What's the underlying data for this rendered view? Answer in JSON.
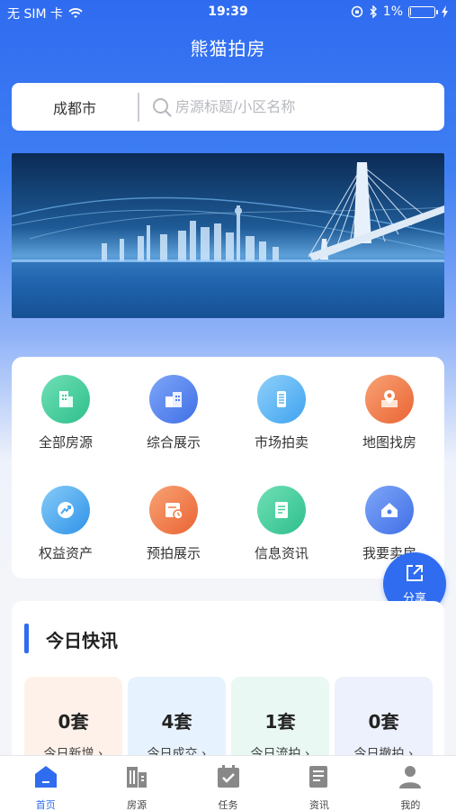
{
  "status_bar": {
    "carrier": "无 SIM 卡",
    "time": "19:39",
    "battery_text": "1%",
    "battery_level": 0.05
  },
  "header": {
    "title": "熊猫拍房"
  },
  "search": {
    "city": "成都市",
    "placeholder": "房源标题/小区名称",
    "value": ""
  },
  "banner": {
    "icon": "city-skyline-bridge-image"
  },
  "menu": {
    "items": [
      {
        "label": "全部房源",
        "icon": "building-icon",
        "color": "#3ecf9c"
      },
      {
        "label": "综合展示",
        "icon": "buildings-icon",
        "color": "#4d7ef0"
      },
      {
        "label": "市场拍卖",
        "icon": "tower-icon",
        "color": "#5db4f3"
      },
      {
        "label": "地图找房",
        "icon": "map-pin-icon",
        "color": "#f07b45"
      },
      {
        "label": "权益资产",
        "icon": "trend-icon",
        "color": "#49a8ef"
      },
      {
        "label": "预拍展示",
        "icon": "calendar-clock-icon",
        "color": "#f07b45"
      },
      {
        "label": "信息资讯",
        "icon": "document-icon",
        "color": "#3ecf9c"
      },
      {
        "label": "我要卖房",
        "icon": "house-tag-icon",
        "color": "#4d7ef0"
      }
    ]
  },
  "share": {
    "label": "分享",
    "icon": "share-icon"
  },
  "news": {
    "title": "今日快讯",
    "stats": [
      {
        "count": "0套",
        "label": "今日新增",
        "bg": "#fdf1ea"
      },
      {
        "count": "4套",
        "label": "今日成交",
        "bg": "#e7f2ff"
      },
      {
        "count": "1套",
        "label": "今日流拍",
        "bg": "#e9f8f2"
      },
      {
        "count": "0套",
        "label": "今日撤拍",
        "bg": "#edf1fd"
      }
    ]
  },
  "tabbar": {
    "items": [
      {
        "label": "首页",
        "icon": "home-icon",
        "active": true
      },
      {
        "label": "房源",
        "icon": "buildings-icon",
        "active": false
      },
      {
        "label": "任务",
        "icon": "calendar-check-icon",
        "active": false
      },
      {
        "label": "资讯",
        "icon": "newspaper-icon",
        "active": false
      },
      {
        "label": "我的",
        "icon": "user-icon",
        "active": false
      }
    ]
  },
  "colors": {
    "primary": "#2f6cf0",
    "tab_inactive": "#888888"
  }
}
